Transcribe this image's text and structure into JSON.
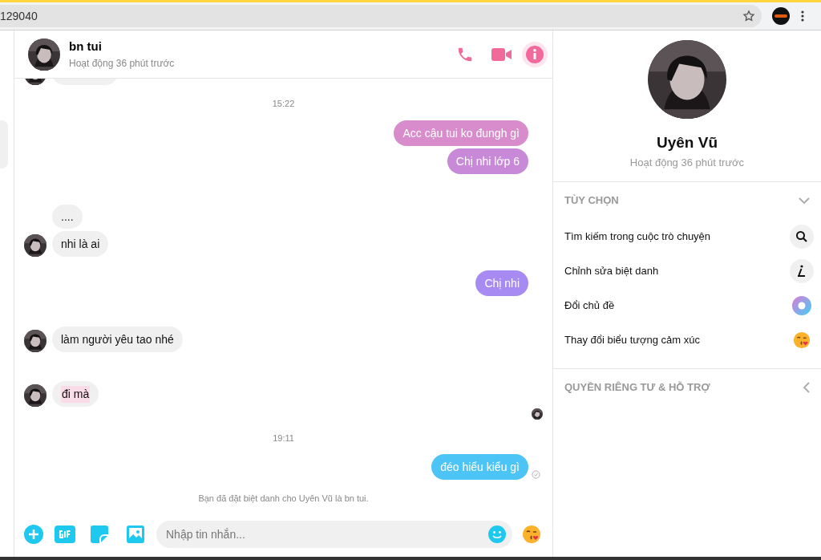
{
  "browser": {
    "address": "129040"
  },
  "header": {
    "name": "bn tui",
    "status": "Hoạt động 36 phút trước"
  },
  "messages": [
    {
      "kind": "clipped"
    },
    {
      "kind": "time",
      "text": "15:22"
    },
    {
      "kind": "out",
      "text": "Acc cậu tui ko đungh gì",
      "color": "#d88ccc"
    },
    {
      "kind": "out",
      "text": "Chị nhi lớp 6",
      "color": "#c88ad8"
    },
    {
      "kind": "in",
      "text": "....",
      "avatar": false,
      "highlighted": false
    },
    {
      "kind": "in",
      "text": "nhi là ai",
      "avatar": true,
      "highlighted": false
    },
    {
      "kind": "out",
      "text": "Chị nhi",
      "color": "#a78bf2"
    },
    {
      "kind": "in",
      "text": "làm người yêu tao nhé",
      "avatar": true,
      "highlighted": false
    },
    {
      "kind": "in",
      "text": "đi mà",
      "avatar": true,
      "highlighted": true
    },
    {
      "kind": "seen"
    },
    {
      "kind": "time",
      "text": "19:11"
    },
    {
      "kind": "out",
      "text": "đéo hiểu kiểu gì",
      "color": "#4cc4f6",
      "sent": true
    },
    {
      "kind": "notice",
      "text": "Bạn đã đặt biệt danh cho Uyên Vũ là bn tui."
    }
  ],
  "composer": {
    "placeholder": "Nhập tin nhắn..."
  },
  "profile": {
    "name": "Uyên Vũ",
    "status": "Hoạt động 36 phút trước"
  },
  "sections": [
    {
      "title": "TÙY CHỌN",
      "expanded": true,
      "items": [
        {
          "label": "Tìm kiếm trong cuộc trò chuyện",
          "kind": "search"
        },
        {
          "label": "Chỉnh sửa biệt danh",
          "kind": "nickname"
        },
        {
          "label": "Đổi chủ đề",
          "kind": "theme"
        },
        {
          "label": "Thay đổi biểu tượng cảm xúc",
          "kind": "emoji"
        }
      ]
    },
    {
      "title": "QUYỀN RIÊNG TƯ & HỖ TRỢ",
      "expanded": false
    }
  ]
}
